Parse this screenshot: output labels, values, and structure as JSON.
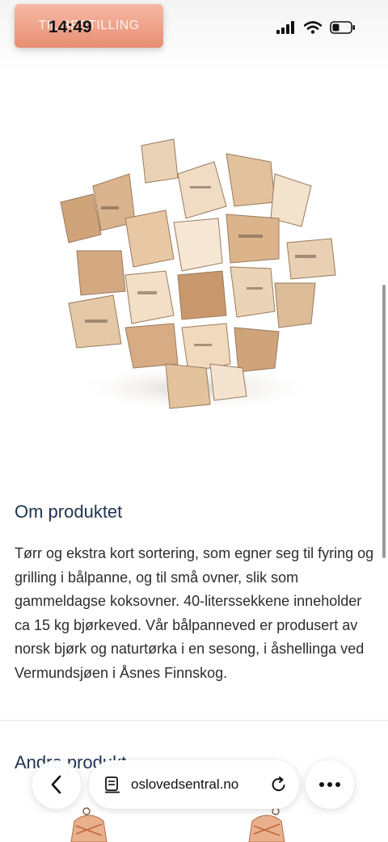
{
  "status_bar": {
    "time": "14:49",
    "icons": [
      "cellular-signal-icon",
      "wifi-icon",
      "battery-icon"
    ]
  },
  "header": {
    "order_button_label": "TIL BESTILLING"
  },
  "product": {
    "image": "firewood-pile-image"
  },
  "about": {
    "title": "Om produktet",
    "text": "Tørr og ekstra kort sortering, som egner seg til fyring og grilling i bålpanne, og til små ovner, slik som gammeldagse koksovner. 40-literssekkene inneholder ca 15 kg bjørkeved. Vår bålpanneved er produsert av norsk bjørk og naturtørka i en sesong, i åshellinga ved Vermundsjøen i Åsnes Finnskog."
  },
  "other_products": {
    "title": "Andre produkt"
  },
  "browser": {
    "url": "oslovedsentral.no",
    "icons": [
      "back-chevron-icon",
      "page-menu-icon",
      "reload-icon",
      "more-icon"
    ]
  },
  "colors": {
    "accent": "#e88e73",
    "heading": "#1e3350"
  }
}
